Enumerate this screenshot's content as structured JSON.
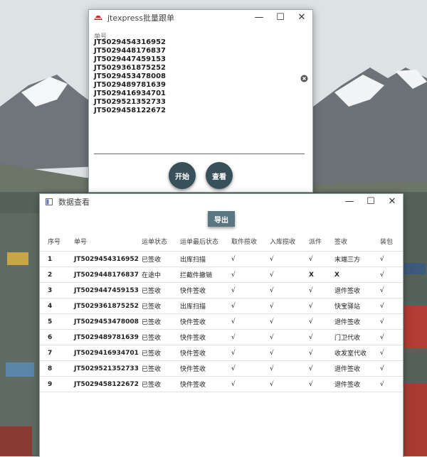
{
  "win1": {
    "title": "jtexpress批量跟单",
    "field_label": "单号",
    "numbers_text": "JT5029454316952\nJT5029448176837\nJT5029447459153\nJT5029361875252\nJT5029453478008\nJT5029489781639\nJT5029416934701\nJT5029521352733\nJT5029458122672",
    "start_label": "开始",
    "view_label": "查看",
    "accent": "#37505a"
  },
  "win2": {
    "title": "数据查看",
    "export_label": "导出",
    "columns": [
      "序号",
      "单号",
      "运单状态",
      "运单最后状态",
      "取件揽收",
      "入库揽收",
      "派件",
      "签收",
      "装包"
    ],
    "rows": [
      [
        "1",
        "JT5029454316952",
        "已签收",
        "出库扫描",
        "√",
        "√",
        "√",
        "末端三方",
        "√"
      ],
      [
        "2",
        "JT5029448176837",
        "在途中",
        "拦截件撤销",
        "√",
        "√",
        "X",
        "X",
        "√"
      ],
      [
        "3",
        "JT5029447459153",
        "已签收",
        "快件签收",
        "√",
        "√",
        "√",
        "退件签收",
        "√"
      ],
      [
        "4",
        "JT5029361875252",
        "已签收",
        "出库扫描",
        "√",
        "√",
        "√",
        "快宝驿站",
        "√"
      ],
      [
        "5",
        "JT5029453478008",
        "已签收",
        "快件签收",
        "√",
        "√",
        "√",
        "退件签收",
        "√"
      ],
      [
        "6",
        "JT5029489781639",
        "已签收",
        "快件签收",
        "√",
        "√",
        "√",
        "门卫代收",
        "√"
      ],
      [
        "7",
        "JT5029416934701",
        "已签收",
        "快件签收",
        "√",
        "√",
        "√",
        "收发室代收",
        "√"
      ],
      [
        "8",
        "JT5029521352733",
        "已签收",
        "快件签收",
        "√",
        "√",
        "√",
        "退件签收",
        "√"
      ],
      [
        "9",
        "JT5029458122672",
        "已签收",
        "快件签收",
        "√",
        "√",
        "√",
        "退件签收",
        "√"
      ]
    ]
  },
  "controls": {
    "minimize": "—",
    "maximize": "☐",
    "close": "✕"
  }
}
